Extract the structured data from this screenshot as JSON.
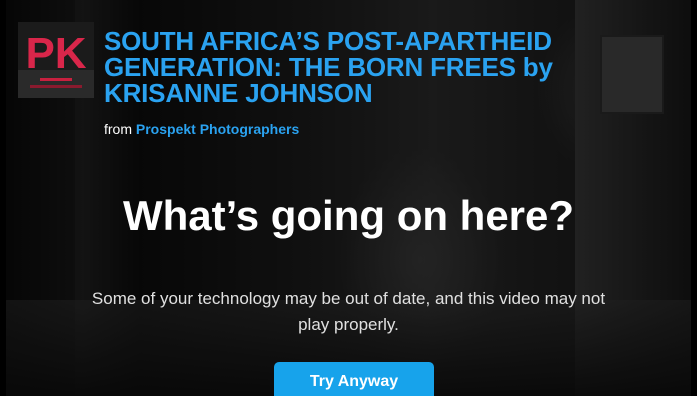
{
  "video": {
    "title": "SOUTH AFRICA’S POST-APARTHEID GENERATION: THE BORN FREES by KRISANNE JOHNSON",
    "byline_prefix": "from",
    "channel_name": "Prospekt Photographers",
    "channel_logo_text": "PK"
  },
  "notice": {
    "heading": "What’s going on here?",
    "message": "Some of your technology may be out of date, and this video may not play properly.",
    "button_label": "Try Anyway"
  },
  "colors": {
    "accent": "#2aa2f0",
    "button": "#17a3eb",
    "logo_red": "#d9264a"
  }
}
